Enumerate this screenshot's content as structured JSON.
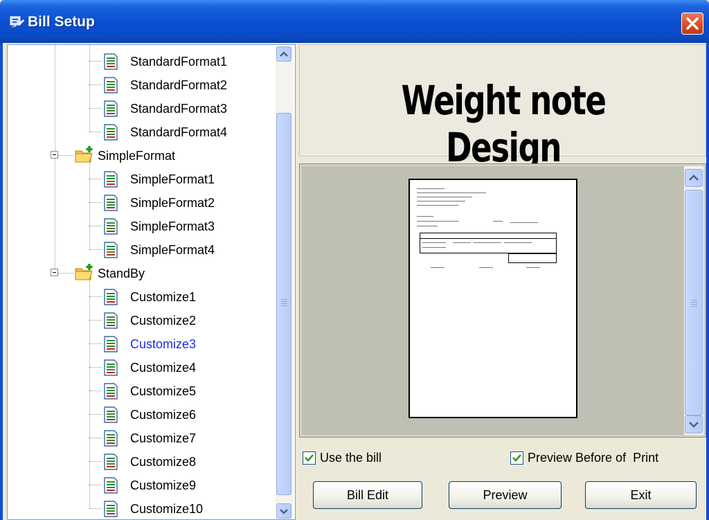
{
  "window": {
    "title": "Bill Setup"
  },
  "tree": {
    "items": [
      {
        "label": "StandardFormat1"
      },
      {
        "label": "StandardFormat2"
      },
      {
        "label": "StandardFormat3"
      },
      {
        "label": "StandardFormat4"
      },
      {
        "label": "SimpleFormat"
      },
      {
        "label": "SimpleFormat1"
      },
      {
        "label": "SimpleFormat2"
      },
      {
        "label": "SimpleFormat3"
      },
      {
        "label": "SimpleFormat4"
      },
      {
        "label": "StandBy"
      },
      {
        "label": "Customize1"
      },
      {
        "label": "Customize2"
      },
      {
        "label": "Customize3"
      },
      {
        "label": "Customize4"
      },
      {
        "label": "Customize5"
      },
      {
        "label": "Customize6"
      },
      {
        "label": "Customize7"
      },
      {
        "label": "Customize8"
      },
      {
        "label": "Customize9"
      },
      {
        "label": "Customize10"
      }
    ],
    "selected": "Customize3"
  },
  "header": {
    "title": "Weight note Design"
  },
  "options": {
    "use_bill": {
      "label": "Use the bill",
      "checked": true
    },
    "preview_before_print": {
      "label": "Preview Before of  Print",
      "checked": true
    }
  },
  "buttons": {
    "bill_edit": "Bill Edit",
    "preview": "Preview",
    "exit": "Exit"
  },
  "colors": {
    "titlebar": "#0a4fd2",
    "selected_text": "#1a2ee8",
    "close": "#d94a1f"
  }
}
